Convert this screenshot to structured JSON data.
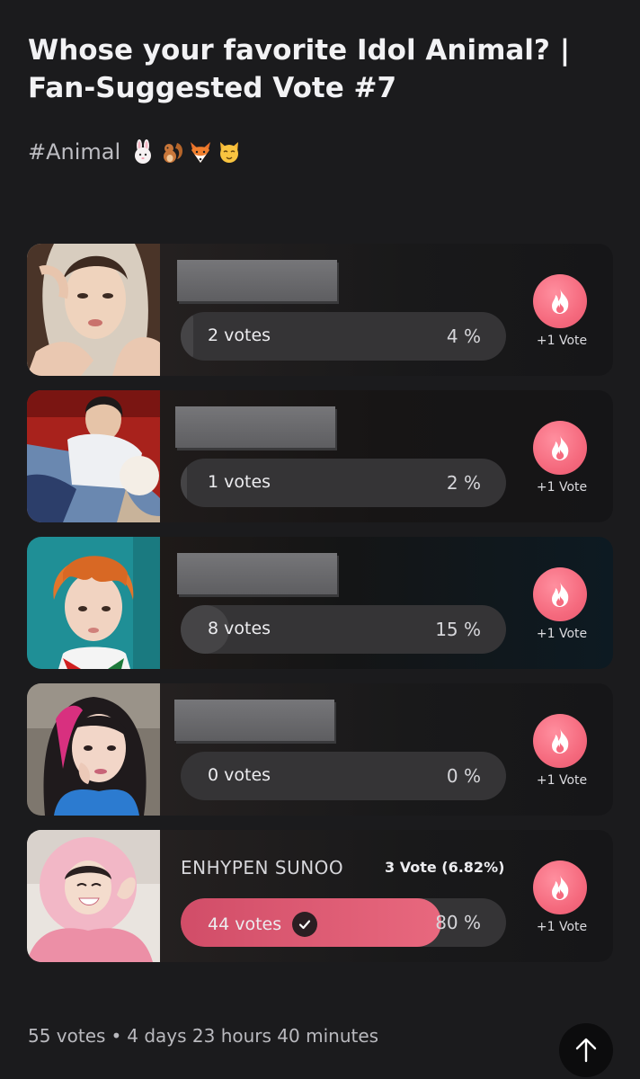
{
  "poll": {
    "title": "Whose your favorite Idol Animal? | Fan-Suggested Vote #7",
    "tag": "#Animal",
    "emoji_icons": [
      "rabbit-icon",
      "squirrel-icon",
      "fox-icon",
      "cat-icon"
    ]
  },
  "options": [
    {
      "votes_label": "2 votes",
      "percent_label": "4 %",
      "share": 0.04,
      "vote_button_label": "+1 Vote"
    },
    {
      "votes_label": "1 votes",
      "percent_label": "2 %",
      "share": 0.02,
      "vote_button_label": "+1 Vote"
    },
    {
      "votes_label": "8 votes",
      "percent_label": "15 %",
      "share": 0.15,
      "vote_button_label": "+1 Vote"
    },
    {
      "votes_label": "0 votes",
      "percent_label": "0 %",
      "share": 0.0,
      "vote_button_label": "+1 Vote"
    },
    {
      "name": "ENHYPEN SUNOO",
      "my_vote_label": "3 Vote (6.82%)",
      "votes_label": "44 votes",
      "percent_label": "80 %",
      "share": 0.8,
      "vote_button_label": "+1 Vote",
      "selected": true
    }
  ],
  "footer": {
    "total_votes": "55 votes",
    "separator": "•",
    "time_left": "4 days 23 hours 40 minutes"
  },
  "colors": {
    "accent": "#f56a7e",
    "selected_bar": "#e2607a",
    "background": "#1b1b1d"
  }
}
